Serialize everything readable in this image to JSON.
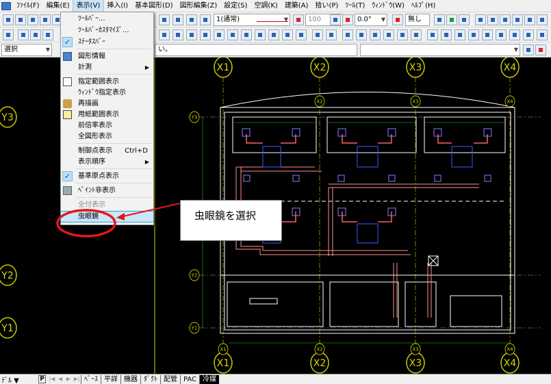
{
  "menubar": {
    "items": [
      "ﾌｧｲﾙ(F)",
      "編集(E)",
      "表示(V)",
      "挿入(I)",
      "基本図形(D)",
      "図形編集(Z)",
      "設定(S)",
      "空調(K)",
      "建築(A)",
      "拾い(P)",
      "ﾂｰﾙ(T)",
      "ｳｨﾝﾄﾞｳ(W)",
      "ﾍﾙﾌﾟ(H)"
    ]
  },
  "toolbar": {
    "linetype": "1(通常)",
    "weight": "100",
    "angle": "0.0°",
    "color_mode": "無し"
  },
  "optionbar": {
    "mode_select": "選択",
    "message": "い。"
  },
  "view_menu": {
    "items": [
      {
        "label": "ﾂｰﾙﾊﾞｰ...",
        "icon": "",
        "checked": false
      },
      {
        "label": "ﾂｰﾙﾊﾞｰｶｽﾀﾏｲｽﾞ...",
        "icon": "",
        "checked": false
      },
      {
        "label": "ｽﾃｰﾀｽﾊﾞｰ",
        "icon": "check-icon",
        "checked": true
      },
      {
        "label": "図形情報",
        "icon": "info-window-icon",
        "checked": false
      },
      {
        "label": "計測",
        "icon": "",
        "checked": false,
        "submenu": true
      },
      {
        "label": "指定範囲表示",
        "icon": "range-view-icon",
        "checked": false
      },
      {
        "label": "ｳｨﾝﾄﾞｳ指定表示",
        "icon": "",
        "checked": false
      },
      {
        "label": "再描画",
        "icon": "redraw-brush-icon",
        "checked": false
      },
      {
        "label": "用紙範囲表示",
        "icon": "paper-range-icon",
        "checked": false
      },
      {
        "label": "前倍率表示",
        "icon": "",
        "checked": false
      },
      {
        "label": "全図形表示",
        "icon": "",
        "checked": false
      },
      {
        "label": "制御点表示",
        "icon": "",
        "checked": false,
        "shortcut": "Ctrl+D"
      },
      {
        "label": "表示順序",
        "icon": "",
        "checked": false,
        "submenu": true
      },
      {
        "label": "基準原点表示",
        "icon": "check-icon",
        "checked": true
      },
      {
        "label": "ﾍﾟｲﾝﾄ非表示",
        "icon": "paint-hide-icon",
        "checked": false
      },
      {
        "label": "虫眼鏡",
        "icon": "",
        "checked": false,
        "highlighted": true
      }
    ],
    "obscured_item": "全付表示"
  },
  "annotation": {
    "callout_text": "虫眼鏡を選択",
    "accent_color": "#e8151b"
  },
  "drawing": {
    "grid_top": [
      "X1",
      "X2",
      "X3",
      "X4"
    ],
    "grid_bottom": [
      "X1",
      "X2",
      "X3",
      "X4"
    ],
    "grid_left": [
      "Y3",
      "Y2",
      "Y1"
    ],
    "plan_top": [
      "X2",
      "X3",
      "X4"
    ],
    "plan_left": [
      "Y3",
      "Y2",
      "Y1"
    ],
    "plan_bottom": [
      "X1",
      "X2",
      "X3",
      "X4"
    ]
  },
  "tabs": {
    "layer": "ﾃﾞﾙ",
    "p_label": "P",
    "sheets": [
      "ﾍﾞｰｽ",
      "平詳",
      "機器",
      "ﾀﾞｸﾄ",
      "配管",
      "PAC",
      "冷媒"
    ],
    "active_index": 6
  }
}
